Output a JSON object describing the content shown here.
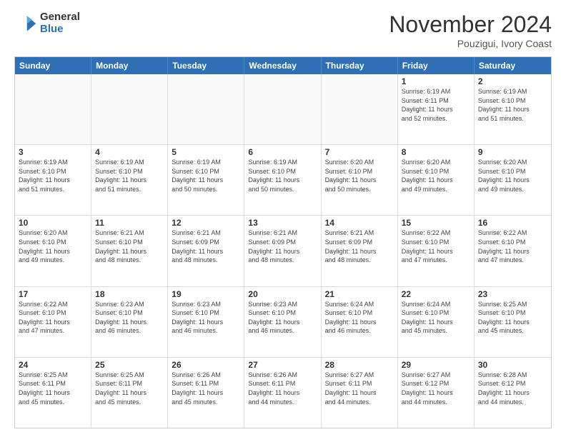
{
  "logo": {
    "general": "General",
    "blue": "Blue"
  },
  "title": "November 2024",
  "location": "Pouzigui, Ivory Coast",
  "header_days": [
    "Sunday",
    "Monday",
    "Tuesday",
    "Wednesday",
    "Thursday",
    "Friday",
    "Saturday"
  ],
  "rows": [
    [
      {
        "day": "",
        "info": ""
      },
      {
        "day": "",
        "info": ""
      },
      {
        "day": "",
        "info": ""
      },
      {
        "day": "",
        "info": ""
      },
      {
        "day": "",
        "info": ""
      },
      {
        "day": "1",
        "info": "Sunrise: 6:19 AM\nSunset: 6:11 PM\nDaylight: 11 hours\nand 52 minutes."
      },
      {
        "day": "2",
        "info": "Sunrise: 6:19 AM\nSunset: 6:10 PM\nDaylight: 11 hours\nand 51 minutes."
      }
    ],
    [
      {
        "day": "3",
        "info": "Sunrise: 6:19 AM\nSunset: 6:10 PM\nDaylight: 11 hours\nand 51 minutes."
      },
      {
        "day": "4",
        "info": "Sunrise: 6:19 AM\nSunset: 6:10 PM\nDaylight: 11 hours\nand 51 minutes."
      },
      {
        "day": "5",
        "info": "Sunrise: 6:19 AM\nSunset: 6:10 PM\nDaylight: 11 hours\nand 50 minutes."
      },
      {
        "day": "6",
        "info": "Sunrise: 6:19 AM\nSunset: 6:10 PM\nDaylight: 11 hours\nand 50 minutes."
      },
      {
        "day": "7",
        "info": "Sunrise: 6:20 AM\nSunset: 6:10 PM\nDaylight: 11 hours\nand 50 minutes."
      },
      {
        "day": "8",
        "info": "Sunrise: 6:20 AM\nSunset: 6:10 PM\nDaylight: 11 hours\nand 49 minutes."
      },
      {
        "day": "9",
        "info": "Sunrise: 6:20 AM\nSunset: 6:10 PM\nDaylight: 11 hours\nand 49 minutes."
      }
    ],
    [
      {
        "day": "10",
        "info": "Sunrise: 6:20 AM\nSunset: 6:10 PM\nDaylight: 11 hours\nand 49 minutes."
      },
      {
        "day": "11",
        "info": "Sunrise: 6:21 AM\nSunset: 6:10 PM\nDaylight: 11 hours\nand 48 minutes."
      },
      {
        "day": "12",
        "info": "Sunrise: 6:21 AM\nSunset: 6:09 PM\nDaylight: 11 hours\nand 48 minutes."
      },
      {
        "day": "13",
        "info": "Sunrise: 6:21 AM\nSunset: 6:09 PM\nDaylight: 11 hours\nand 48 minutes."
      },
      {
        "day": "14",
        "info": "Sunrise: 6:21 AM\nSunset: 6:09 PM\nDaylight: 11 hours\nand 48 minutes."
      },
      {
        "day": "15",
        "info": "Sunrise: 6:22 AM\nSunset: 6:10 PM\nDaylight: 11 hours\nand 47 minutes."
      },
      {
        "day": "16",
        "info": "Sunrise: 6:22 AM\nSunset: 6:10 PM\nDaylight: 11 hours\nand 47 minutes."
      }
    ],
    [
      {
        "day": "17",
        "info": "Sunrise: 6:22 AM\nSunset: 6:10 PM\nDaylight: 11 hours\nand 47 minutes."
      },
      {
        "day": "18",
        "info": "Sunrise: 6:23 AM\nSunset: 6:10 PM\nDaylight: 11 hours\nand 46 minutes."
      },
      {
        "day": "19",
        "info": "Sunrise: 6:23 AM\nSunset: 6:10 PM\nDaylight: 11 hours\nand 46 minutes."
      },
      {
        "day": "20",
        "info": "Sunrise: 6:23 AM\nSunset: 6:10 PM\nDaylight: 11 hours\nand 46 minutes."
      },
      {
        "day": "21",
        "info": "Sunrise: 6:24 AM\nSunset: 6:10 PM\nDaylight: 11 hours\nand 46 minutes."
      },
      {
        "day": "22",
        "info": "Sunrise: 6:24 AM\nSunset: 6:10 PM\nDaylight: 11 hours\nand 45 minutes."
      },
      {
        "day": "23",
        "info": "Sunrise: 6:25 AM\nSunset: 6:10 PM\nDaylight: 11 hours\nand 45 minutes."
      }
    ],
    [
      {
        "day": "24",
        "info": "Sunrise: 6:25 AM\nSunset: 6:11 PM\nDaylight: 11 hours\nand 45 minutes."
      },
      {
        "day": "25",
        "info": "Sunrise: 6:25 AM\nSunset: 6:11 PM\nDaylight: 11 hours\nand 45 minutes."
      },
      {
        "day": "26",
        "info": "Sunrise: 6:26 AM\nSunset: 6:11 PM\nDaylight: 11 hours\nand 45 minutes."
      },
      {
        "day": "27",
        "info": "Sunrise: 6:26 AM\nSunset: 6:11 PM\nDaylight: 11 hours\nand 44 minutes."
      },
      {
        "day": "28",
        "info": "Sunrise: 6:27 AM\nSunset: 6:11 PM\nDaylight: 11 hours\nand 44 minutes."
      },
      {
        "day": "29",
        "info": "Sunrise: 6:27 AM\nSunset: 6:12 PM\nDaylight: 11 hours\nand 44 minutes."
      },
      {
        "day": "30",
        "info": "Sunrise: 6:28 AM\nSunset: 6:12 PM\nDaylight: 11 hours\nand 44 minutes."
      }
    ]
  ]
}
